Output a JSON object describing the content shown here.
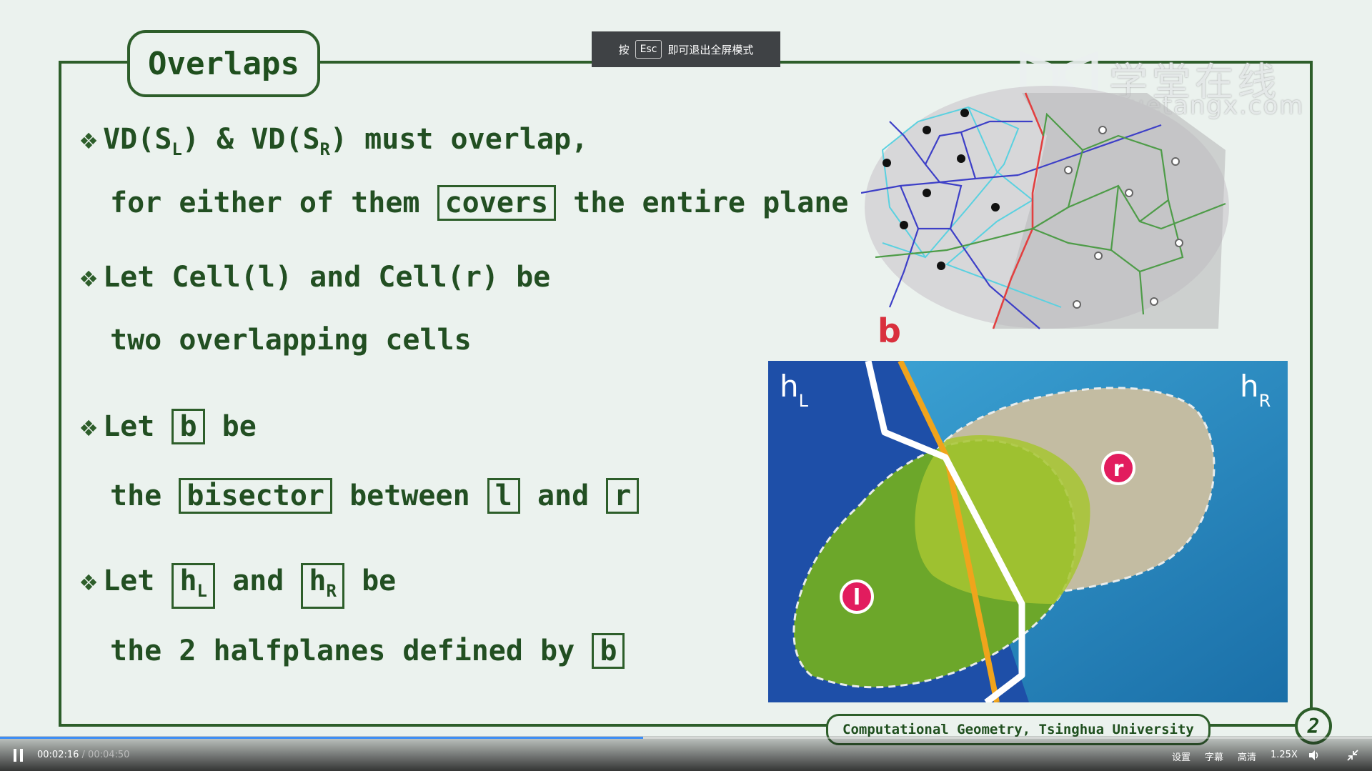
{
  "slide": {
    "title": "Overlaps",
    "bullet_symbol": "❖",
    "lines": {
      "l1_pre": "VD(S",
      "l1_sub1": "L",
      "l1_mid": ") & VD(S",
      "l1_sub2": "R",
      "l1_post": ") must overlap,",
      "l2_pre": "for either of them",
      "l2_box": "covers",
      "l2_post": "the entire plane",
      "l3": "Let Cell(l) and Cell(r) be",
      "l4": "two overlapping cells",
      "l5_pre": "Let",
      "l5_box": "b",
      "l5_post": "be",
      "l6_pre": "the",
      "l6_box1": "bisector",
      "l6_mid": "between",
      "l6_box2": "l",
      "l6_and": "and",
      "l6_box3": "r",
      "l7_pre": "Let",
      "l7_box1": "h",
      "l7_box1_sub": "L",
      "l7_and": "and",
      "l7_box2": "h",
      "l7_box2_sub": "R",
      "l7_post": "be",
      "l8_pre": "the 2 halfplanes defined by",
      "l8_box": "b"
    },
    "diagram": {
      "b_label": "b",
      "hl": "h",
      "hl_sub": "L",
      "hr": "h",
      "hr_sub": "R",
      "cell_l": "l",
      "cell_r": "r"
    },
    "footer": "Computational Geometry, Tsinghua University",
    "page": "2"
  },
  "overlay": {
    "esc_prefix": "按",
    "esc_key": "Esc",
    "esc_suffix": "即可退出全屏模式"
  },
  "watermark": {
    "cn": "学堂在线",
    "en": "xuetangx.com"
  },
  "player": {
    "current": "00:02:16",
    "separator": " / ",
    "total": "00:04:50",
    "progress_fraction": 0.469,
    "settings": "设置",
    "subtitles": "字幕",
    "quality": "高清",
    "speed": "1.25X",
    "icons": [
      "pause-icon",
      "volume-icon",
      "exit-fullscreen-icon"
    ]
  },
  "colors": {
    "accent": "#2d5e2a",
    "bisector": "#d9303d",
    "progress": "#3d8ef5"
  }
}
